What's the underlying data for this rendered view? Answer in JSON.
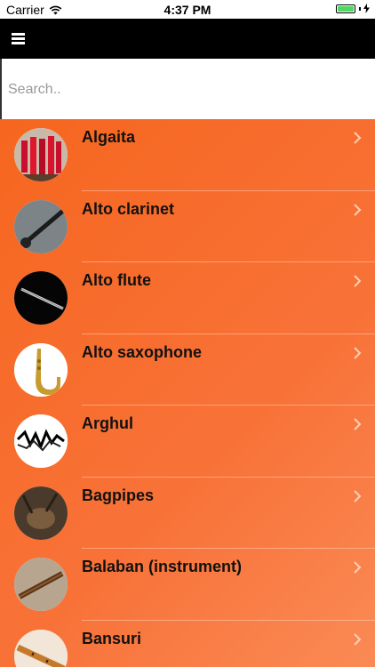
{
  "status_bar": {
    "carrier": "Carrier",
    "time": "4:37 PM",
    "battery_color": "#4cd964"
  },
  "nav": {
    "menu_icon": "hamburger-icon"
  },
  "search": {
    "placeholder": "Search.."
  },
  "list": {
    "accent": "#f6661f",
    "items": [
      {
        "label": "Algaita",
        "thumb": "algaita-thumbnail"
      },
      {
        "label": "Alto clarinet",
        "thumb": "alto-clarinet-thumbnail"
      },
      {
        "label": "Alto flute",
        "thumb": "alto-flute-thumbnail"
      },
      {
        "label": "Alto saxophone",
        "thumb": "alto-saxophone-thumbnail"
      },
      {
        "label": "Arghul",
        "thumb": "arghul-thumbnail"
      },
      {
        "label": "Bagpipes",
        "thumb": "bagpipes-thumbnail"
      },
      {
        "label": "Balaban (instrument)",
        "thumb": "balaban-thumbnail"
      },
      {
        "label": "Bansuri",
        "thumb": "bansuri-thumbnail"
      }
    ]
  }
}
